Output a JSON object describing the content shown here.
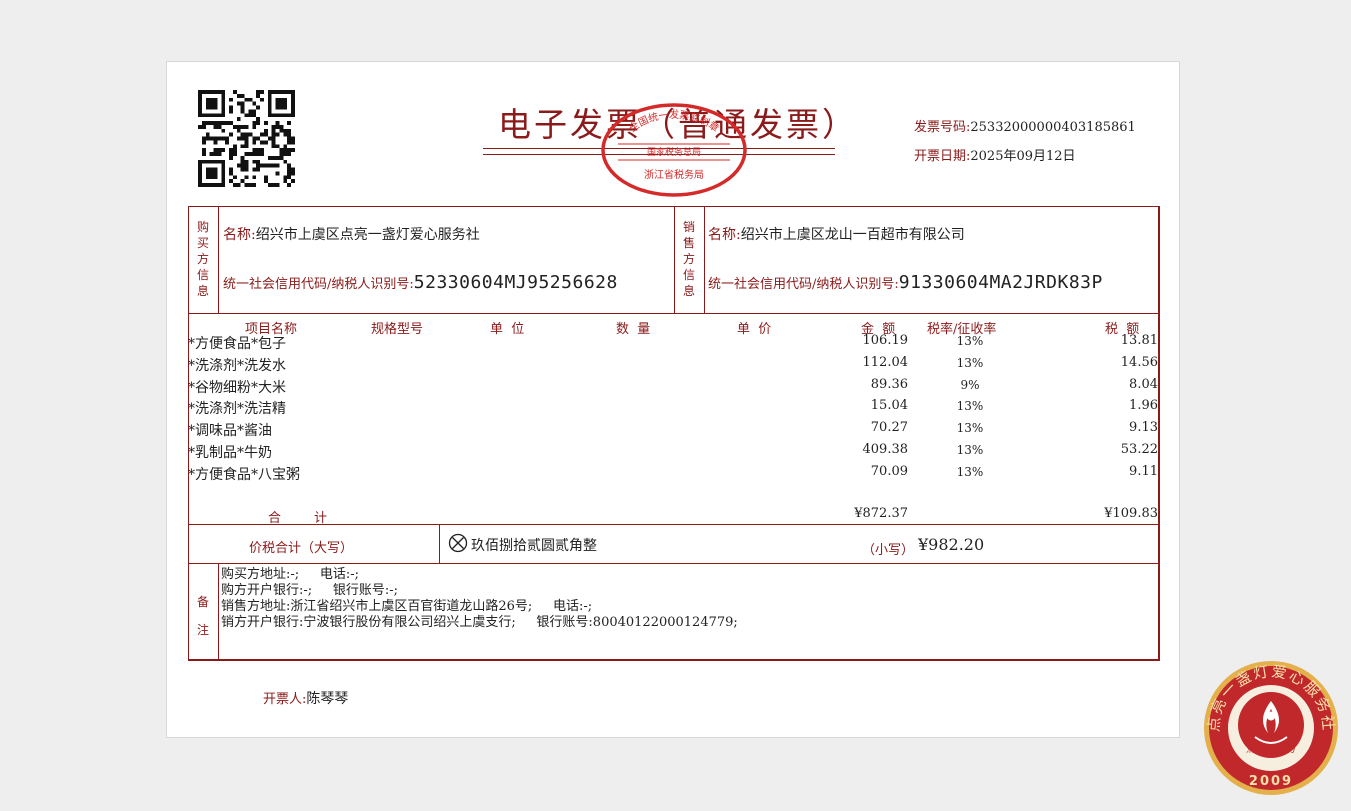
{
  "invoice": {
    "title": "电子发票（普通发票）",
    "number_label": "发票号码:",
    "number": "25332000000403185861",
    "date_label": "开票日期:",
    "date": "2025年09月12日"
  },
  "seal": {
    "top_text": "全国统一发票监制章",
    "middle_text": "国家税务总局",
    "bottom_text": "浙江省税务局"
  },
  "buyer": {
    "side_label": [
      "购",
      "买",
      "方",
      "信",
      "息"
    ],
    "name_label": "名称:",
    "name": "绍兴市上虞区点亮一盏灯爱心服务社",
    "tax_label": "统一社会信用代码/纳税人识别号:",
    "tax_id": "52330604MJ95256628"
  },
  "seller": {
    "side_label": [
      "销",
      "售",
      "方",
      "信",
      "息"
    ],
    "name_label": "名称:",
    "name": "绍兴市上虞区龙山一百超市有限公司",
    "tax_label": "统一社会信用代码/纳税人识别号:",
    "tax_id": "91330604MA2JRDK83P"
  },
  "table": {
    "headers": {
      "item": "项目名称",
      "spec": "规格型号",
      "unit": "单  位",
      "qty": "数  量",
      "price": "单  价",
      "amount": "金  额",
      "rate": "税率/征收率",
      "tax": "税  额"
    },
    "rows": [
      {
        "name": "*方便食品*包子",
        "amount": "106.19",
        "rate": "13%",
        "tax": "13.81"
      },
      {
        "name": "*洗涤剂*洗发水",
        "amount": "112.04",
        "rate": "13%",
        "tax": "14.56"
      },
      {
        "name": "*谷物细粉*大米",
        "amount": "89.36",
        "rate": "9%",
        "tax": "8.04"
      },
      {
        "name": "*洗涤剂*洗洁精",
        "amount": "15.04",
        "rate": "13%",
        "tax": "1.96"
      },
      {
        "name": "*调味品*酱油",
        "amount": "70.27",
        "rate": "13%",
        "tax": "9.13"
      },
      {
        "name": "*乳制品*牛奶",
        "amount": "409.38",
        "rate": "13%",
        "tax": "53.22"
      },
      {
        "name": "*方便食品*八宝粥",
        "amount": "70.09",
        "rate": "13%",
        "tax": "9.11"
      }
    ],
    "total_label": "合        计",
    "total_amount": "¥872.37",
    "total_tax": "¥109.83"
  },
  "grand_total": {
    "label": "价税合计（大写）",
    "words": "玖佰捌拾贰圆贰角整",
    "small_label": "（小写）",
    "small_value": "¥982.20"
  },
  "remarks": {
    "side_label": [
      "备",
      "注"
    ],
    "line1": "购买方地址:-;     电话:-;",
    "line2": "购方开户银行:-;     银行账号:-;",
    "line3": "销售方地址:浙江省绍兴市上虞区百官街道龙山路26号;     电话:-;",
    "line4": "销方开户银行:宁波银行股份有限公司绍兴上虞支行;     银行账号:80040122000124779;"
  },
  "issuer": {
    "label": "开票人:",
    "name": "陈琴琴"
  },
  "stamp": {
    "ring_text": "点亮一盏灯爱心服务社",
    "inner_text": "点亮一盏灯",
    "year": "2009"
  },
  "colors": {
    "accent": "#8b1a1a",
    "seal_red": "#d42a2a",
    "stamp_red": "#c0282b",
    "stamp_gold": "#e3b04b"
  }
}
